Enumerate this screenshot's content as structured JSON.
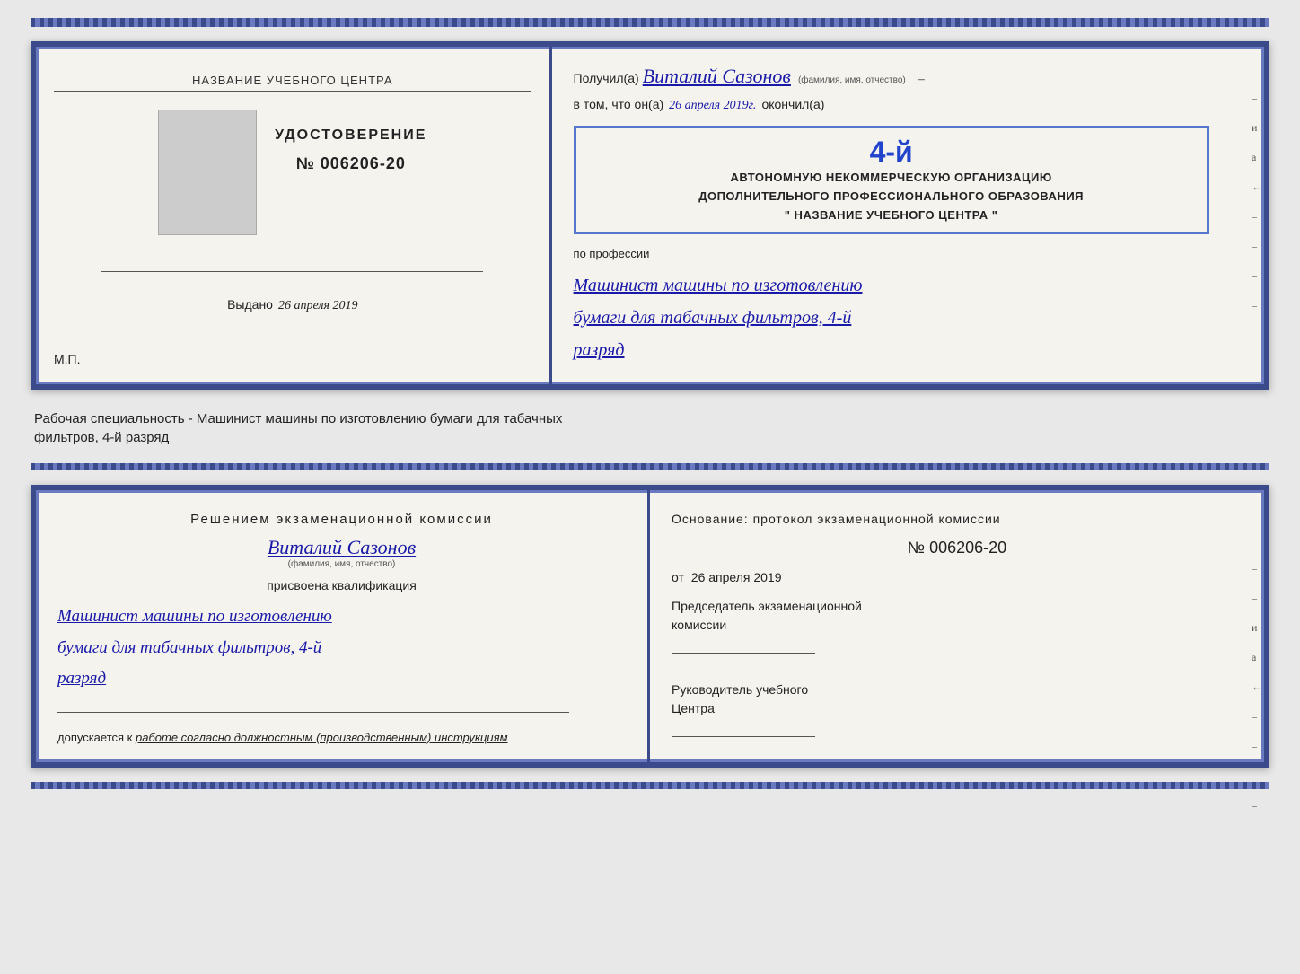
{
  "top_cert": {
    "left": {
      "org_label": "НАЗВАНИЕ УЧЕБНОГО ЦЕНТРА",
      "cert_title": "УДОСТОВЕРЕНИЕ",
      "cert_number": "№ 006206-20",
      "issued_label": "Выдано",
      "issued_date": "26 апреля 2019",
      "mp": "М.П."
    },
    "right": {
      "recipient_prefix": "Получил(а)",
      "recipient_name": "Виталий Сазонов",
      "fio_hint": "(фамилия, имя, отчество)",
      "dash": "–",
      "v_tom_label": "в том, что он(а)",
      "v_tom_date": "26 апреля 2019г.",
      "okonchil": "окончил(а)",
      "stamp_number": "4-й",
      "stamp_line1": "АВТОНОМНУЮ НЕКОММЕРЧЕСКУЮ ОРГАНИЗАЦИЮ",
      "stamp_line2": "ДОПОЛНИТЕЛЬНОГО ПРОФЕССИОНАЛЬНОГО ОБРАЗОВАНИЯ",
      "stamp_line3": "\" НАЗВАНИЕ УЧЕБНОГО ЦЕНТРА \"",
      "i_label": "и",
      "a_label": "а",
      "arrow_label": "←",
      "po_professii": "по профессии",
      "profession_line1": "Машинист машины по изготовлению",
      "profession_line2": "бумаги для табачных фильтров, 4-й",
      "profession_line3": "разряд"
    }
  },
  "between": {
    "text1": "Рабочая специальность - Машинист машины по изготовлению бумаги для табачных",
    "text2": "фильтров, 4-й разряд"
  },
  "bottom_cert": {
    "left": {
      "heading": "Решением  экзаменационной  комиссии",
      "person_name": "Виталий Сазонов",
      "fio_hint": "(фамилия, имя, отчество)",
      "prisvoena": "присвоена квалификация",
      "profession_line1": "Машинист машины по изготовлению",
      "profession_line2": "бумаги для табачных фильтров, 4-й",
      "profession_line3": "разряд",
      "dopusk_prefix": "допускается к",
      "dopusk_text": "работе согласно должностным (производственным) инструкциям"
    },
    "right": {
      "osnovanie": "Основание:  протокол  экзаменационной  комиссии",
      "protocol_number": "№  006206-20",
      "ot_prefix": "от",
      "ot_date": "26 апреля 2019",
      "predsedatel_line1": "Председатель экзаменационной",
      "predsedatel_line2": "комиссии",
      "rukovoditel_line1": "Руководитель учебного",
      "rukovoditel_line2": "Центра",
      "side_i": "и",
      "side_a": "а",
      "side_arrow": "←"
    }
  }
}
